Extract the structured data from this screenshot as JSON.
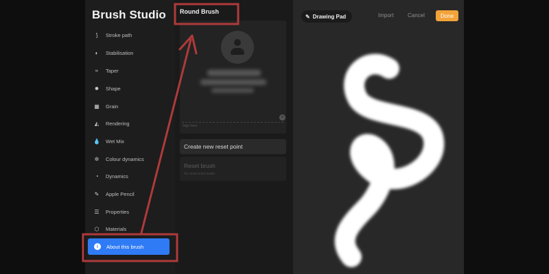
{
  "sidebar": {
    "title": "Brush Studio",
    "items": [
      {
        "label": "Stroke path",
        "icon": "stroke-path-icon",
        "glyph": "⟆"
      },
      {
        "label": "Stabilisation",
        "icon": "stabilisation-icon",
        "glyph": "◐"
      },
      {
        "label": "Taper",
        "icon": "taper-icon",
        "glyph": "≈"
      },
      {
        "label": "Shape",
        "icon": "shape-icon",
        "glyph": "✸"
      },
      {
        "label": "Grain",
        "icon": "grain-icon",
        "glyph": "▦"
      },
      {
        "label": "Rendering",
        "icon": "rendering-icon",
        "glyph": "◭"
      },
      {
        "label": "Wet Mix",
        "icon": "wet-mix-icon",
        "glyph": "💧"
      },
      {
        "label": "Colour dynamics",
        "icon": "colour-dynamics-icon",
        "glyph": "✲"
      },
      {
        "label": "Dynamics",
        "icon": "dynamics-icon",
        "glyph": "◔"
      },
      {
        "label": "Apple Pencil",
        "icon": "apple-pencil-icon",
        "glyph": "✎"
      },
      {
        "label": "Properties",
        "icon": "properties-icon",
        "glyph": "☰"
      },
      {
        "label": "Materials",
        "icon": "materials-icon",
        "glyph": "⬡"
      }
    ],
    "active_item": {
      "label": "About this brush",
      "icon": "info-icon",
      "glyph": "i"
    }
  },
  "middle": {
    "title": "Round Brush",
    "sign_here": "Sign here",
    "clear_glyph": "×",
    "create_reset": "Create new reset point",
    "reset_title": "Reset brush",
    "reset_subtitle": "No reset point made"
  },
  "right": {
    "pad_icon": "✎",
    "pad_label": "Drawing Pad",
    "import_label": "Import",
    "cancel_label": "Cancel",
    "done_label": "Done"
  },
  "colors": {
    "accent": "#2f7bf6",
    "done": "#f2a33a",
    "annotation": "#b03a3a"
  }
}
